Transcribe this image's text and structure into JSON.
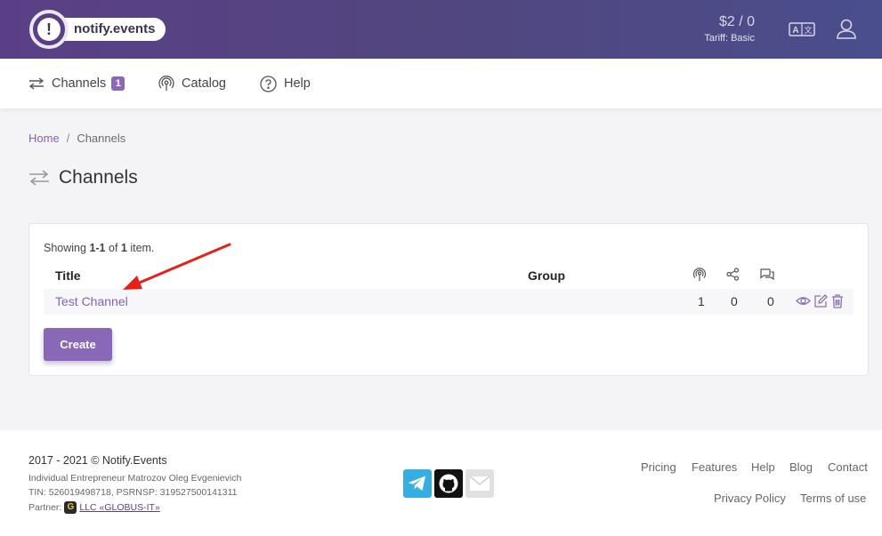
{
  "header": {
    "logo_text": "notify.events",
    "logo_symbol": "!",
    "balance": "$2 / 0",
    "tariff": "Tariff: Basic",
    "lang_icon": "translate-icon",
    "user_icon": "user-icon"
  },
  "nav": {
    "channels_label": "Channels",
    "channels_count": "1",
    "catalog_label": "Catalog",
    "help_label": "Help"
  },
  "breadcrumb": {
    "home": "Home",
    "separator": "/",
    "current": "Channels"
  },
  "page": {
    "title": "Channels"
  },
  "grid": {
    "summary_prefix": "Showing ",
    "summary_range": "1-1",
    "summary_of": " of ",
    "summary_total": "1",
    "summary_suffix": " item.",
    "columns": {
      "title": "Title",
      "group": "Group",
      "sources_icon": "broadcast-icon",
      "recipients_icon": "share-icon",
      "messages_icon": "chat-icon"
    },
    "rows": [
      {
        "title": "Test Channel",
        "group": "",
        "sources": "1",
        "recipients": "0",
        "messages": "0"
      }
    ],
    "create_label": "Create"
  },
  "footer": {
    "copyright": "2017 - 2021 © Notify.Events",
    "legal_line1": "Individual Entrepreneur Matrozov Oleg Evgenievich",
    "legal_line2": "TIN: 526019498718, PSRNSP: 319527500141311",
    "partner_label": "Partner:",
    "partner_name": "LLC «GLOBUS-IT»",
    "links_row1": [
      "Pricing",
      "Features",
      "Help",
      "Blog",
      "Contact"
    ],
    "links_row2": [
      "Privacy Policy",
      "Terms of use"
    ]
  },
  "colors": {
    "header_start": "#5b3f86",
    "header_end": "#4a4e8c",
    "accent": "#8a68b8",
    "link": "#8563b4"
  }
}
